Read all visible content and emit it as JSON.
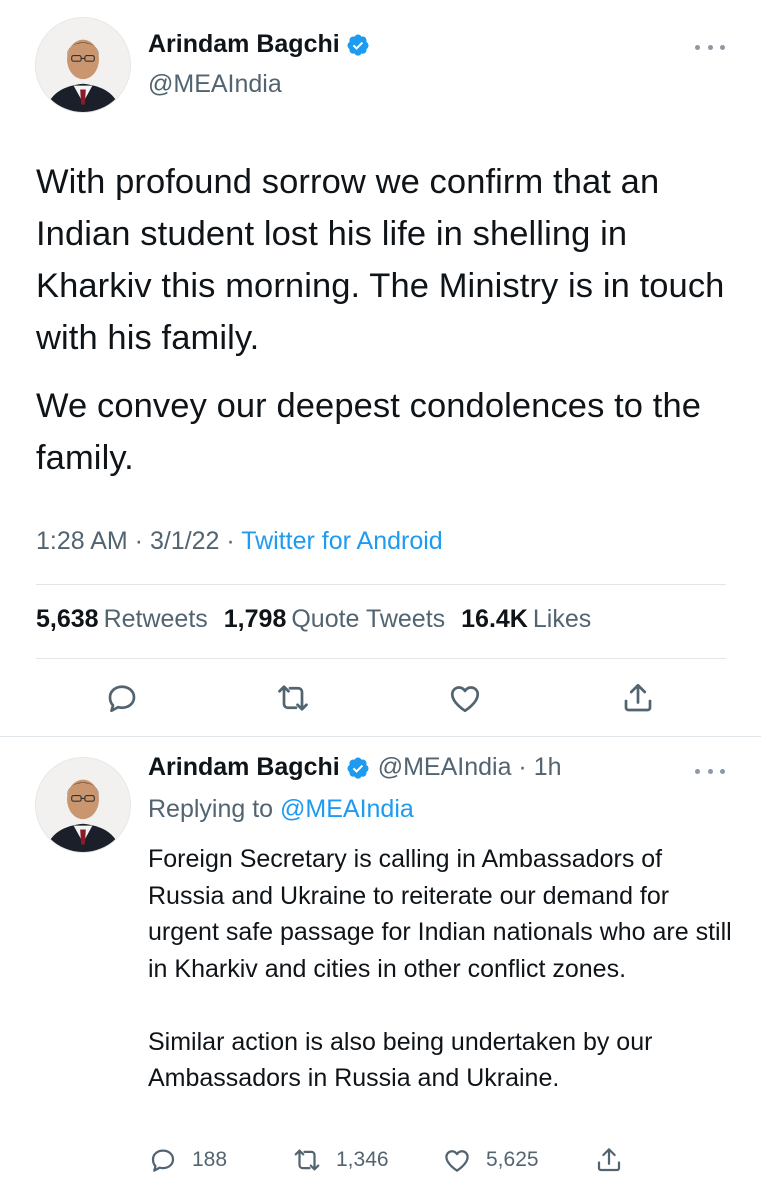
{
  "main_tweet": {
    "author": {
      "name": "Arindam Bagchi",
      "handle": "@MEAIndia"
    },
    "text": [
      "With profound sorrow we confirm that an Indian student lost his life in shelling in Kharkiv this morning. The Ministry is in touch with his family.",
      "We convey our deepest condolences to the family."
    ],
    "meta": {
      "time": "1:28 AM",
      "date": "3/1/22",
      "separator": " · ",
      "source": "Twitter for Android"
    },
    "stats": [
      {
        "value": "5,638",
        "label": "Retweets"
      },
      {
        "value": "1,798",
        "label": "Quote Tweets"
      },
      {
        "value": "16.4K",
        "label": "Likes"
      }
    ],
    "actions": [
      "reply-icon",
      "retweet-icon",
      "like-icon",
      "share-icon"
    ]
  },
  "reply_tweet": {
    "author": {
      "name": "Arindam Bagchi",
      "handle": "@MEAIndia",
      "age": "1h",
      "separator": " · "
    },
    "replying_label": "Replying to ",
    "replying_to": "@MEAIndia",
    "text": [
      "Foreign Secretary is calling in Ambassadors of Russia and Ukraine to reiterate our demand for urgent safe passage for Indian nationals who are still in Kharkiv and cities in other conflict zones.",
      "Similar action is also being undertaken by our Ambassadors in Russia and Ukraine."
    ],
    "counts": {
      "replies": "188",
      "retweets": "1,346",
      "likes": "5,625"
    }
  },
  "colors": {
    "accent": "#1d9bf0",
    "text": "#0f1419",
    "secondary": "#536471",
    "divider": "#e1e6ea"
  }
}
